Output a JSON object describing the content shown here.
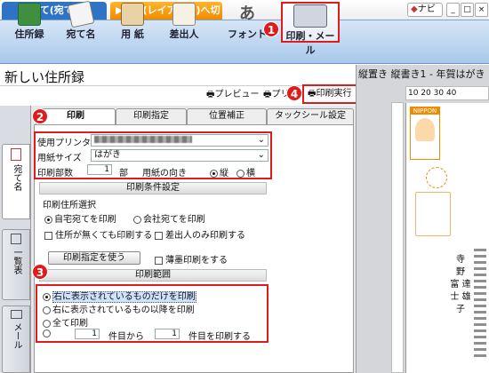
{
  "tabs": [
    {
      "label": "おもて(宛て名)"
    },
    {
      "label": "▶うら(レイアウト)へ切替"
    }
  ],
  "top_right": {
    "navi_label": "ナビ",
    "min": "_",
    "max": "□",
    "close": "×"
  },
  "toolbar": [
    {
      "label": "住所録"
    },
    {
      "label": "宛て名"
    },
    {
      "label": "用 紙"
    },
    {
      "label": "差出人"
    },
    {
      "label": "フォント"
    },
    {
      "label": "印刷・メール"
    }
  ],
  "title": "新しい住所録",
  "subbar": {
    "preview": "プレビュー",
    "print_set": "プリン",
    "exec": "印刷実行"
  },
  "right": {
    "title": "縦置き 縦書き1 - 年賀はがき",
    "ruler": "10  20  30  40",
    "stamp_text": "NIPPON",
    "name_lines": [
      "寺",
      "野",
      "富 達",
      "士 雄",
      "子"
    ]
  },
  "vtabs": [
    {
      "label": "宛て名"
    },
    {
      "label": "一覧表"
    },
    {
      "label": "メール"
    }
  ],
  "print_tabs": [
    {
      "label": "印刷"
    },
    {
      "label": "印刷指定"
    },
    {
      "label": "位置補正"
    },
    {
      "label": "タックシール設定"
    }
  ],
  "printer": {
    "printer_label": "使用プリンター",
    "paper_label": "用紙サイズ",
    "paper_value": "はがき",
    "copies_label": "印刷部数",
    "copies_value": "1",
    "copies_unit": "部",
    "orient_label": "用紙の向き",
    "orient_portrait": "縦",
    "orient_landscape": "横"
  },
  "conditions": {
    "header": "印刷条件設定",
    "target_label": "印刷住所選択",
    "opt_home": "自宅宛てを印刷",
    "opt_company": "会社宛てを印刷",
    "chk_no_address": "住所が無くても印刷する",
    "chk_sender_only": "差出人のみ印刷する",
    "btn_use_spec": "印刷指定を使う",
    "chk_light": "薄墨印刷をする"
  },
  "range": {
    "header": "印刷範囲",
    "opt_current": "右に表示されているものだけを印刷",
    "opt_after": "右に表示されているもの以降を印刷",
    "opt_all": "全て印刷",
    "from_value": "1",
    "from_label": "件目から",
    "to_value": "1",
    "to_label": "件目を印刷する"
  },
  "badges": [
    "1",
    "2",
    "3",
    "4"
  ]
}
